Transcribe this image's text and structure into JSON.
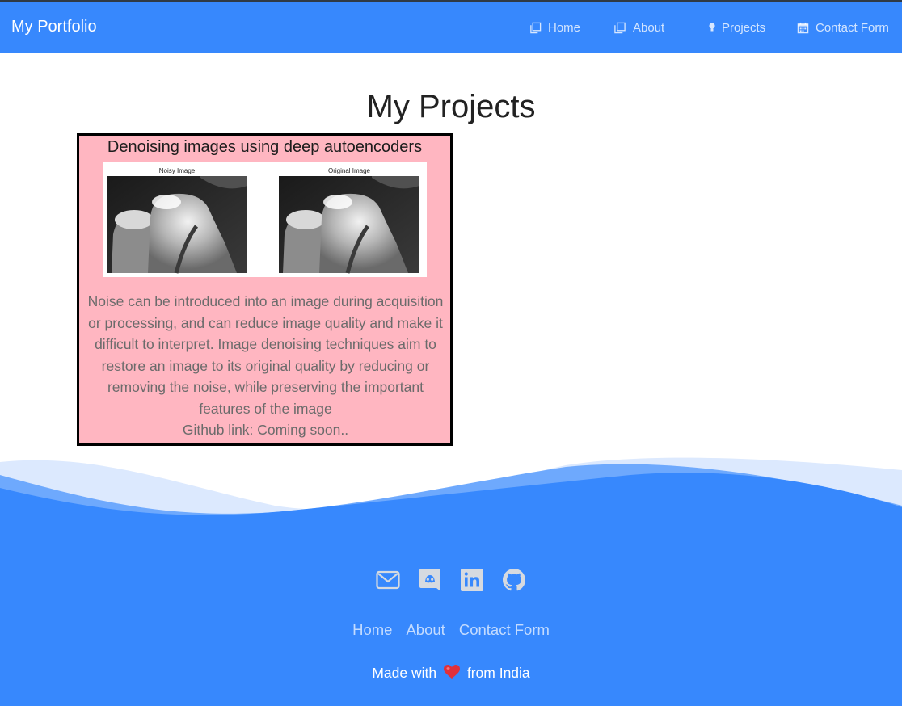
{
  "navbar": {
    "brand": "My Portfolio",
    "links": [
      {
        "label": "Home",
        "icon": "home-icon"
      },
      {
        "label": "About",
        "icon": "about-icon"
      },
      {
        "label": "Projects",
        "icon": "lightbulb-icon"
      },
      {
        "label": "Contact Form",
        "icon": "calendar-icon"
      }
    ]
  },
  "main": {
    "title": "My Projects",
    "projects": [
      {
        "title": "Denoising images using deep autoencoders",
        "image_labels": [
          "Noisy Image",
          "Original Image"
        ],
        "description": "Noise can be introduced into an image during acquisition or processing, and can reduce image quality and make it difficult to interpret. Image denoising techniques aim to restore an image to its original quality by reducing or removing the noise, while preserving the important features of the image",
        "github": "Github link: Coming soon.."
      }
    ]
  },
  "footer": {
    "social": [
      "mail-icon",
      "discord-icon",
      "linkedin-icon",
      "github-icon"
    ],
    "links": [
      "Home",
      "About",
      "Contact Form"
    ],
    "made_with_prefix": "Made with",
    "made_with_suffix": "from India"
  },
  "colors": {
    "primary": "#3788fd",
    "card_bg": "#ffb6c1",
    "footer_icon": "#d6dae0"
  }
}
